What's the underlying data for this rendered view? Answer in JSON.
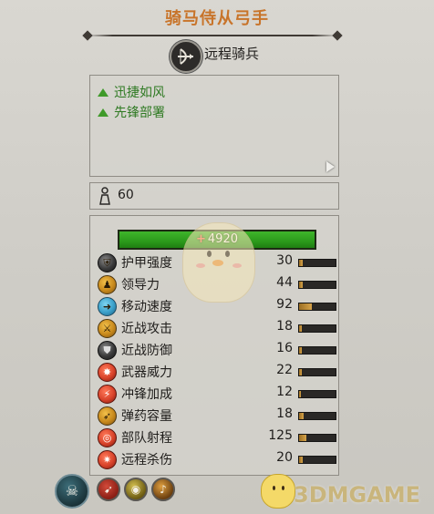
{
  "unit": {
    "name": "骑马侍从弓手",
    "class_label": "远程骑兵",
    "class_icon": "bow-rider-icon"
  },
  "abilities": [
    {
      "label": "迅捷如风"
    },
    {
      "label": "先锋部署"
    }
  ],
  "cost": {
    "value": "60",
    "icon": "upkeep-figure-icon"
  },
  "health": {
    "prefix": "+",
    "value": "4920",
    "color": "#3fb52b"
  },
  "stats": [
    {
      "label": "护甲强度",
      "value": "30",
      "level": 0.1,
      "icon": "armor-icon"
    },
    {
      "label": "领导力",
      "value": "44",
      "level": 0.1,
      "icon": "leadership-icon"
    },
    {
      "label": "移动速度",
      "value": "92",
      "level": 0.35,
      "icon": "speed-icon"
    },
    {
      "label": "近战攻击",
      "value": "18",
      "level": 0.08,
      "icon": "melee-attack-icon"
    },
    {
      "label": "近战防御",
      "value": "16",
      "level": 0.08,
      "icon": "melee-defense-icon"
    },
    {
      "label": "武器威力",
      "value": "22",
      "level": 0.08,
      "icon": "weapon-strength-icon"
    },
    {
      "label": "冲锋加成",
      "value": "12",
      "level": 0.06,
      "icon": "charge-bonus-icon"
    },
    {
      "label": "弹药容量",
      "value": "18",
      "level": 0.12,
      "icon": "ammunition-icon"
    },
    {
      "label": "部队射程",
      "value": "125",
      "level": 0.2,
      "icon": "range-icon"
    },
    {
      "label": "远程杀伤",
      "value": "20",
      "level": 0.1,
      "icon": "missile-damage-icon"
    }
  ],
  "bottom_icons": [
    "faction-skull-icon",
    "fire-arrows-icon",
    "vigilance-eye-icon",
    "horn-icon"
  ],
  "watermark": {
    "text": "3DMGAME"
  }
}
